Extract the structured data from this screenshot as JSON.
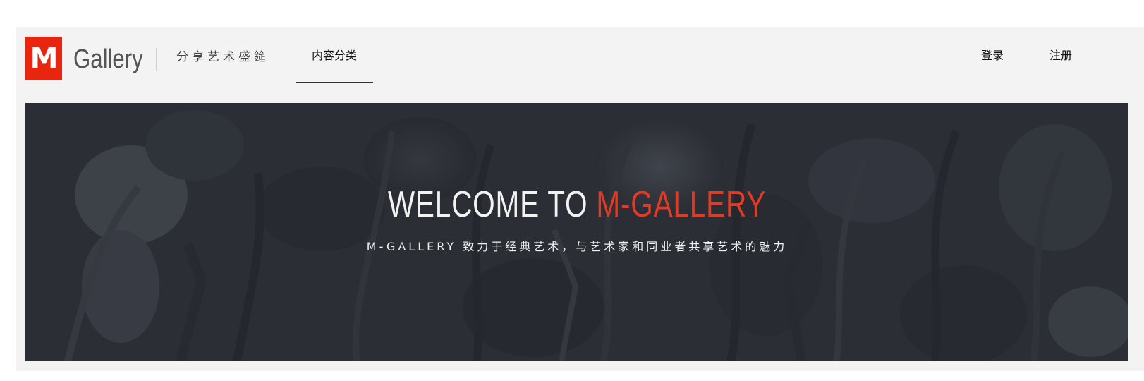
{
  "header": {
    "logo_letter": "M",
    "brand_name": "Gallery",
    "tagline": "分享艺术盛筵",
    "nav": [
      {
        "label": "内容分类",
        "active": true
      }
    ],
    "auth": {
      "login_label": "登录",
      "register_label": "注册"
    }
  },
  "banner": {
    "title_prefix": "WELCOME TO ",
    "title_accent": "M-GALLERY",
    "subtitle": "M-GALLERY 致力于经典艺术，与艺术家和同业者共享艺术的魅力"
  },
  "colors": {
    "brand_red": "#e8260f",
    "accent_red": "#e23a24",
    "banner_bg": "#2e3238",
    "header_bg": "#f3f3f3"
  }
}
